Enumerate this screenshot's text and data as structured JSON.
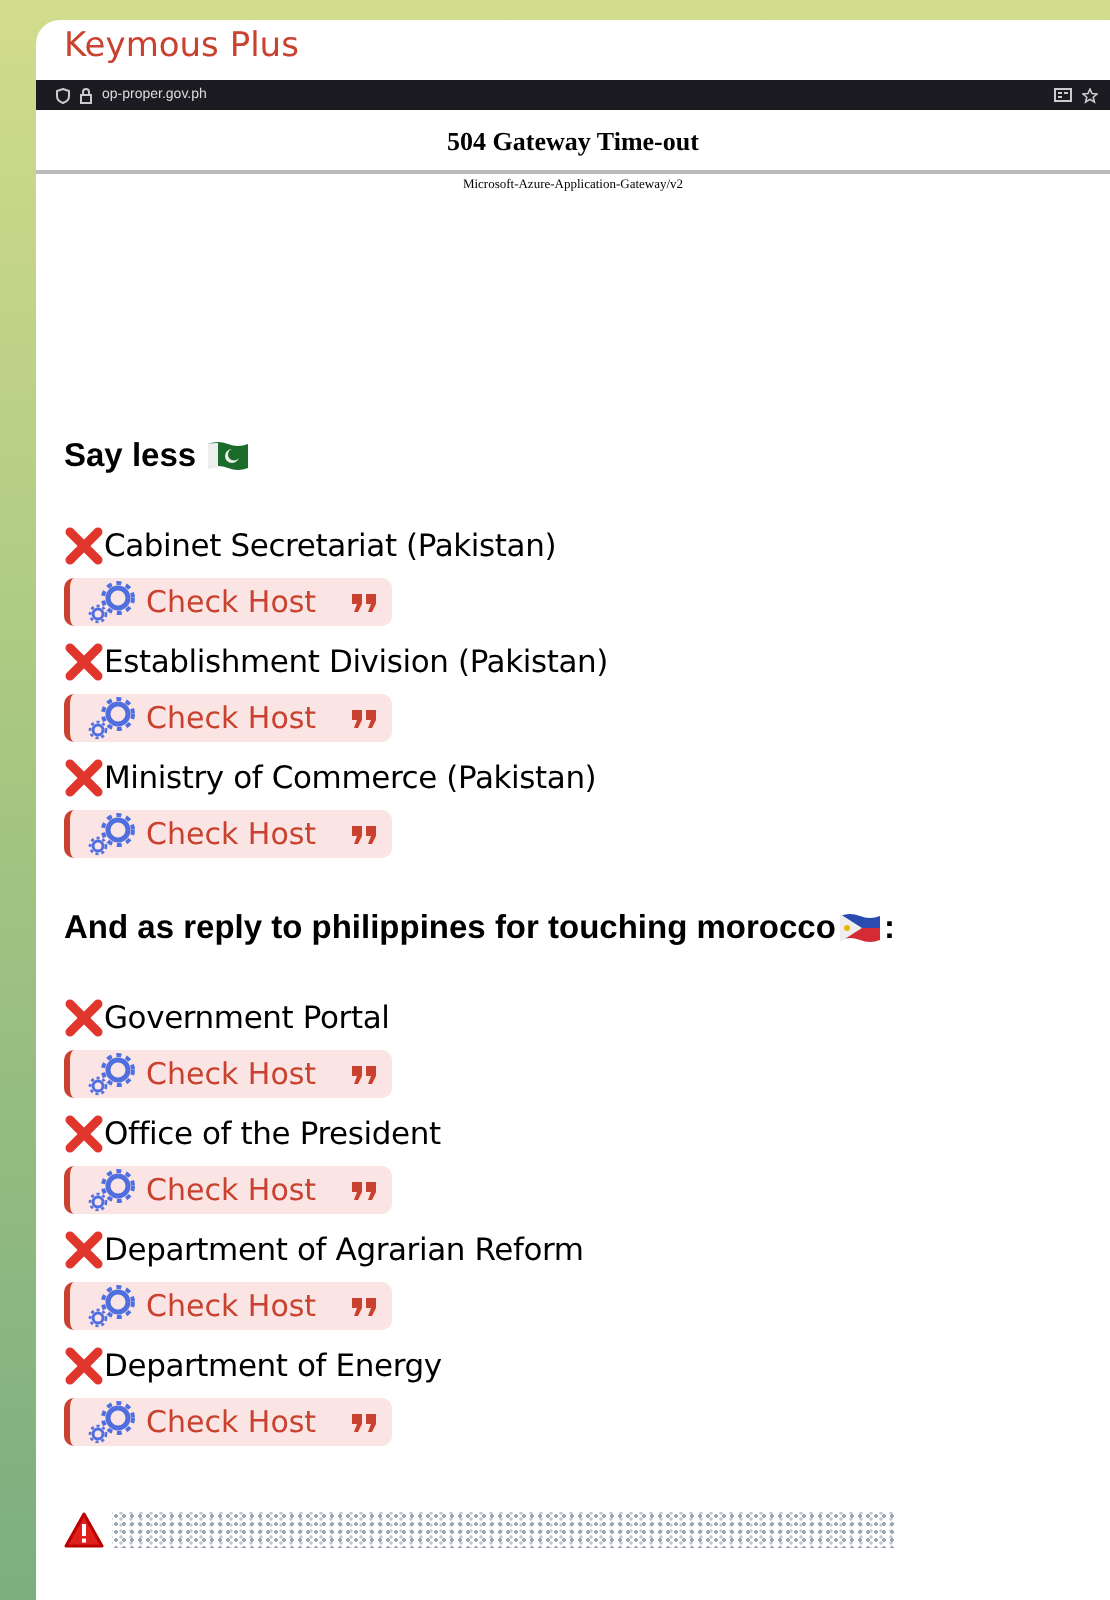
{
  "message": {
    "sender": "Keymous Plus",
    "screenshot": {
      "url": "op-proper.gov.ph",
      "heading": "504 Gateway Time-out",
      "server": "Microsoft-Azure-Application-Gateway/v2"
    },
    "sections": [
      {
        "heading": "Say less",
        "entries": [
          {
            "name": "Cabinet Secretariat (Pakistan)",
            "link": "Check Host"
          },
          {
            "name": "Establishment Division (Pakistan)",
            "link": "Check Host"
          },
          {
            "name": "Ministry of Commerce (Pakistan)",
            "link": "Check Host"
          }
        ]
      },
      {
        "heading": "And as reply to philippines for touching morocco",
        "suffix": ":",
        "entries": [
          {
            "name": "Government Portal",
            "link": "Check Host"
          },
          {
            "name": "Office of the President",
            "link": "Check Host"
          },
          {
            "name": "Department of Agrarian Reform",
            "link": "Check Host"
          },
          {
            "name": "Department of Energy",
            "link": "Check Host"
          }
        ]
      }
    ],
    "footer": {
      "kind": "warning",
      "spoiler": true
    }
  }
}
